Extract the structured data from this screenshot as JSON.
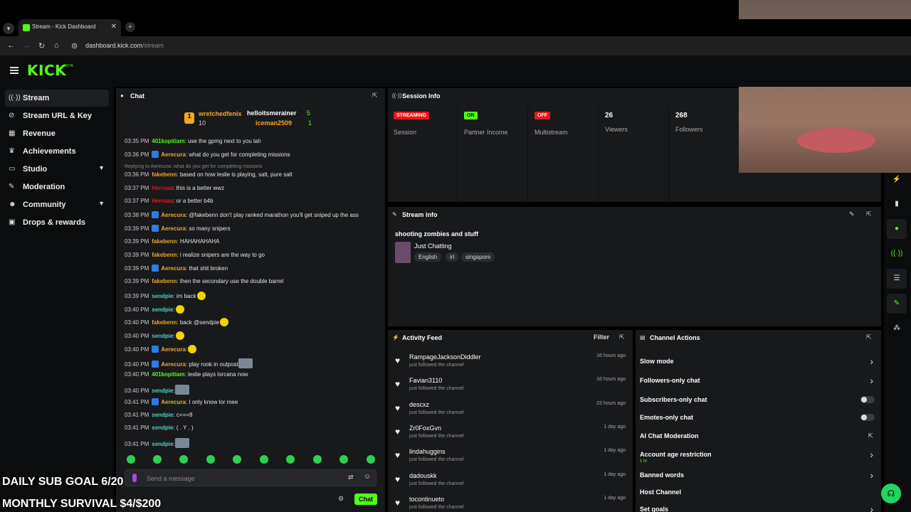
{
  "browser": {
    "tab_title": "Stream - Kick Dashboard",
    "url_domain": "dashboard.kick.com",
    "url_path": "/stream"
  },
  "app": {
    "logo": "KICK",
    "logo_badge": "BETA"
  },
  "sidebar": {
    "items": [
      {
        "label": "Stream",
        "icon": "broadcast-icon"
      },
      {
        "label": "Stream URL & Key",
        "icon": "link-icon"
      },
      {
        "label": "Revenue",
        "icon": "chart-icon"
      },
      {
        "label": "Achievements",
        "icon": "trophy-icon"
      },
      {
        "label": "Studio",
        "icon": "monitor-icon"
      },
      {
        "label": "Moderation",
        "icon": "wrench-icon"
      },
      {
        "label": "Community",
        "icon": "people-icon"
      },
      {
        "label": "Drops & rewards",
        "icon": "gift-icon"
      }
    ]
  },
  "overlay": {
    "line1": "DAILY SUB GOAL 6/20",
    "line2": "MONTHLY SURVIVAL $4/$200"
  },
  "chat": {
    "title": "Chat",
    "leaderboard": {
      "first_name": "wretchedfenix",
      "first_count": "10",
      "second_name": "helloitsmerainer",
      "second_count": "5",
      "third_name": "iceman2509",
      "third_count": "1"
    },
    "messages": [
      {
        "time": "03:35 PM",
        "user": "401kopitiam",
        "color": "#53fc18",
        "text": ": use the gpmg next to you lah"
      },
      {
        "time": "03:36 PM",
        "user": "Aerecura",
        "color": "#f5a623",
        "text": ": what do you get for completing missions",
        "mod": true
      },
      {
        "time": "03:36 PM",
        "user": "fakebenn",
        "color": "#f5a623",
        "text": ": based on how leslie is playing, salt, pure salt"
      },
      {
        "time": "03:37 PM",
        "user": "Herraaa",
        "color": "#e8151b",
        "text": ": this is a better wwz"
      },
      {
        "time": "03:37 PM",
        "user": "Herraaa",
        "color": "#e8151b",
        "text": ": or a better b4b"
      },
      {
        "time": "03:38 PM",
        "user": "Aerecura",
        "color": "#f5a623",
        "text": ": @fakebenn don't play ranked marathon you'll get sniped up the ass",
        "mod": true
      },
      {
        "time": "03:39 PM",
        "user": "Aerecura",
        "color": "#f5a623",
        "text": ": so many snipers",
        "mod": true
      },
      {
        "time": "03:39 PM",
        "user": "fakebenn",
        "color": "#f5a623",
        "text": ": HAHAHAHAHA"
      },
      {
        "time": "03:39 PM",
        "user": "fakebenn",
        "color": "#f5a623",
        "text": ": i realize snipers are the way to go"
      },
      {
        "time": "03:39 PM",
        "user": "Aerecura",
        "color": "#f5a623",
        "text": ": that shit broken",
        "mod": true
      },
      {
        "time": "03:39 PM",
        "user": "fakebenn",
        "color": "#f5a623",
        "text": ": then the secondary use the double barrel"
      },
      {
        "time": "03:39 PM",
        "user": "sendpie",
        "color": "#4fd1c5",
        "text": ": im back",
        "emote": true
      },
      {
        "time": "03:40 PM",
        "user": "sendpie",
        "color": "#4fd1c5",
        "text": ":",
        "emote": true
      },
      {
        "time": "03:40 PM",
        "user": "fakebenn",
        "color": "#f5a623",
        "text": ": back @sendpie",
        "emote": true
      },
      {
        "time": "03:40 PM",
        "user": "sendpie",
        "color": "#4fd1c5",
        "text": ":",
        "emote": true
      },
      {
        "time": "03:40 PM",
        "user": "Aerecura",
        "color": "#f5a623",
        "text": ":",
        "mod": true,
        "emote": true
      },
      {
        "time": "03:40 PM",
        "user": "Aerecura",
        "color": "#f5a623",
        "text": ": play rook in outpost",
        "mod": true,
        "img": true
      },
      {
        "time": "03:40 PM",
        "user": "401kopitiam",
        "color": "#53fc18",
        "text": ": leslie plays lorcana now"
      },
      {
        "time": "03:40 PM",
        "user": "sendpie",
        "color": "#4fd1c5",
        "text": ":",
        "img": true
      },
      {
        "time": "03:41 PM",
        "user": "Aerecura",
        "color": "#f5a623",
        "text": ": I only know lor mee",
        "mod": true
      },
      {
        "time": "03:41 PM",
        "user": "sendpie",
        "color": "#4fd1c5",
        "text": ": c===8"
      },
      {
        "time": "03:41 PM",
        "user": "sendpie",
        "color": "#4fd1c5",
        "text": ": ( . Y . )"
      },
      {
        "time": "03:41 PM",
        "user": "sendpie",
        "color": "#4fd1c5",
        "text": ":",
        "img": true
      }
    ],
    "reply_note": "Replying to Aerecura: what do you get for completing missions",
    "input_placeholder": "Send a message",
    "send_label": "Chat"
  },
  "session": {
    "title": "Session Info",
    "items": [
      {
        "pill": "STREAMING",
        "pill_color": "red",
        "label": "Session"
      },
      {
        "pill": "ON",
        "pill_color": "green",
        "label": "Partner Income"
      },
      {
        "pill": "OFF",
        "pill_color": "red",
        "label": "Multistream"
      }
    ],
    "viewers_value": "26",
    "viewers_label": "Viewers",
    "followers_value": "268",
    "followers_label": "Followers"
  },
  "stream_info": {
    "title": "Stream info",
    "stream_title": "shooting zombies and stuff",
    "category": "Just Chatting",
    "tags": [
      "English",
      "irl",
      "singapore"
    ]
  },
  "activity": {
    "title": "Activity Feed",
    "filter_label": "Filter",
    "items": [
      {
        "name": "RampageJacksonDiddler",
        "sub": "just followed the channel",
        "time": "16 hours ago"
      },
      {
        "name": "Favian3110",
        "sub": "just followed the channel",
        "time": "16 hours ago"
      },
      {
        "name": "descxz",
        "sub": "just followed the channel",
        "time": "23 hours ago"
      },
      {
        "name": "Zr0FoxGvn",
        "sub": "just followed the channel",
        "time": "1 day ago"
      },
      {
        "name": "lindahuggins",
        "sub": "just followed the channel",
        "time": "1 day ago"
      },
      {
        "name": "dadouskk",
        "sub": "just followed the channel",
        "time": "1 day ago"
      },
      {
        "name": "tocontinueto",
        "sub": "just followed the channel",
        "time": "1 day ago"
      }
    ]
  },
  "channel_actions": {
    "title": "Channel Actions",
    "items": [
      {
        "label": "Slow mode",
        "control": "chevron"
      },
      {
        "label": "Followers-only chat",
        "control": "chevron"
      },
      {
        "label": "Subscribers-only chat",
        "control": "toggle"
      },
      {
        "label": "Emotes-only chat",
        "control": "toggle"
      },
      {
        "label": "AI Chat Moderation",
        "control": "external"
      },
      {
        "label": "Account age restriction",
        "sub": "1 hr",
        "control": "chevron"
      },
      {
        "label": "Banned words",
        "control": "chevron"
      },
      {
        "label": "Host Channel",
        "control": "none"
      },
      {
        "label": "Set goals",
        "control": "chevron"
      }
    ]
  },
  "colors": {
    "brand": "#53fc18",
    "live": "#e8151b",
    "panel": "#18191b",
    "bg": "#0b0c0d"
  }
}
